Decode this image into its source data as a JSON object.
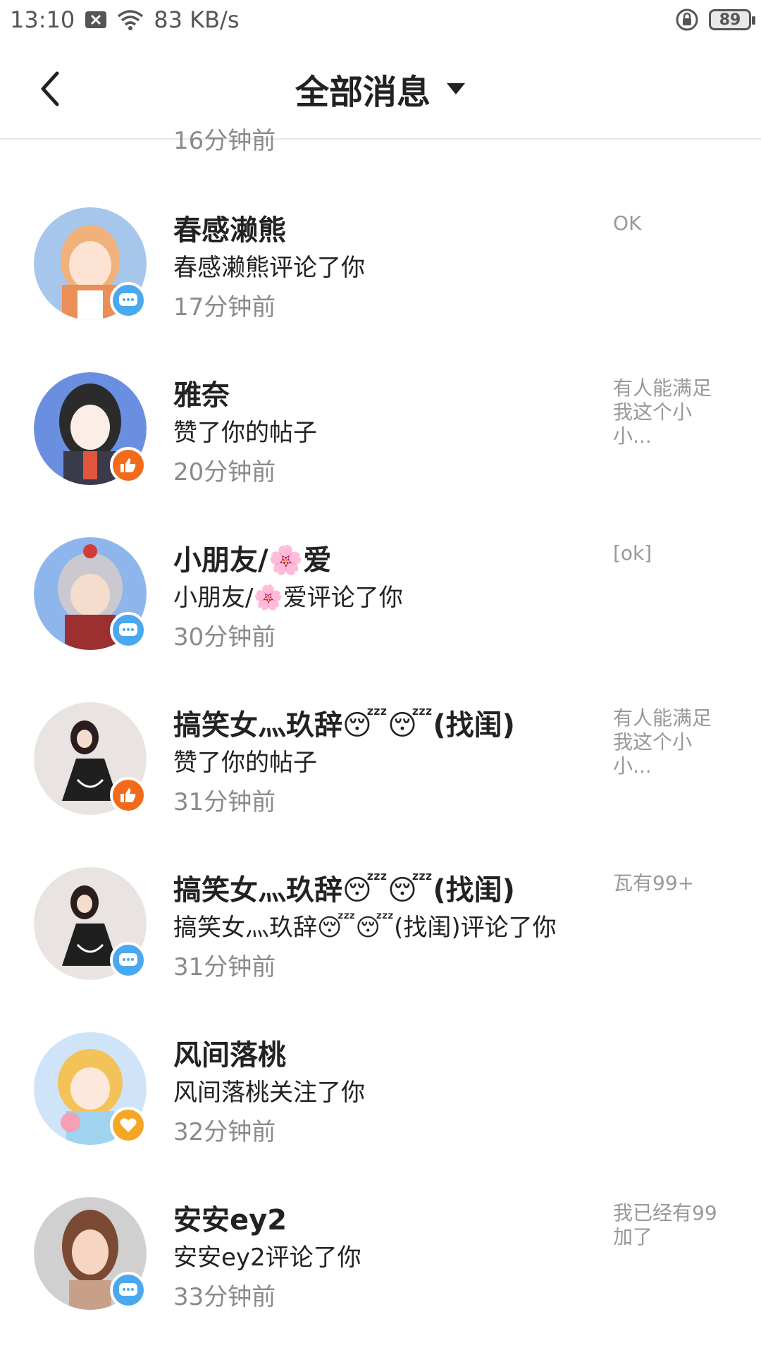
{
  "status_bar": {
    "time": "13:10",
    "network_speed": "83 KB/s",
    "battery": "89",
    "icons": [
      "close-box-icon",
      "wifi-icon",
      "rotation-lock-icon",
      "battery-icon"
    ]
  },
  "header": {
    "title": "全部消息",
    "back_icon": "chevron-left-icon",
    "dropdown_icon": "triangle-down-icon"
  },
  "partial_item": {
    "time": "16分钟前"
  },
  "messages": [
    {
      "name": "春感濑熊",
      "action": "春感濑熊评论了你",
      "time": "17分钟前",
      "preview": "OK",
      "badge": "comment"
    },
    {
      "name": "雅奈",
      "action": "赞了你的帖子",
      "time": "20分钟前",
      "preview": "有人能满足我这个小小...",
      "badge": "like"
    },
    {
      "name": "小朋友/🌸爱",
      "action": "小朋友/🌸爱评论了你",
      "time": "30分钟前",
      "preview": "[ok]",
      "badge": "comment"
    },
    {
      "name": "搞笑女灬玖辞😴😴(找闺)",
      "action": "赞了你的帖子",
      "time": "31分钟前",
      "preview": "有人能满足我这个小小...",
      "badge": "like"
    },
    {
      "name": "搞笑女灬玖辞😴😴(找闺)",
      "action": "搞笑女灬玖辞😴😴(找闺)评论了你",
      "time": "31分钟前",
      "preview": "瓦有99+",
      "badge": "comment"
    },
    {
      "name": "风间落桃",
      "action": "风间落桃关注了你",
      "time": "32分钟前",
      "preview": "",
      "badge": "follow"
    },
    {
      "name": "安安ey2",
      "action": "安安ey2评论了你",
      "time": "33分钟前",
      "preview": "我已经有99加了",
      "badge": "comment"
    }
  ],
  "colors": {
    "comment_badge": "#4aa8f0",
    "like_badge": "#f26a1b",
    "follow_badge": "#f5a623",
    "secondary_text": "#8a8a8a"
  }
}
